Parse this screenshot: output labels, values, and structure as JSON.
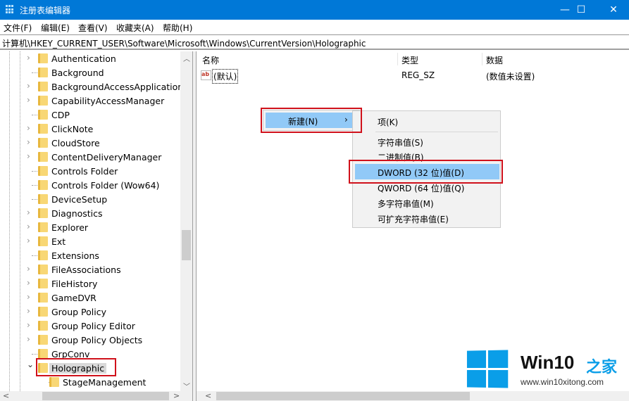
{
  "window": {
    "title": "注册表编辑器",
    "buttons": {
      "minimize": "—",
      "maximize": "☐",
      "close": "✕"
    }
  },
  "menu": [
    "文件(F)",
    "编辑(E)",
    "查看(V)",
    "收藏夹(A)",
    "帮助(H)"
  ],
  "address": "计算机\\HKEY_CURRENT_USER\\Software\\Microsoft\\Windows\\CurrentVersion\\Holographic",
  "tree": {
    "items": [
      {
        "label": "Authentication",
        "expandable": true
      },
      {
        "label": "Background",
        "expandable": false
      },
      {
        "label": "BackgroundAccessApplications",
        "expandable": true
      },
      {
        "label": "CapabilityAccessManager",
        "expandable": true
      },
      {
        "label": "CDP",
        "expandable": false
      },
      {
        "label": "ClickNote",
        "expandable": true
      },
      {
        "label": "CloudStore",
        "expandable": true
      },
      {
        "label": "ContentDeliveryManager",
        "expandable": true
      },
      {
        "label": "Controls Folder",
        "expandable": false
      },
      {
        "label": "Controls Folder (Wow64)",
        "expandable": false
      },
      {
        "label": "DeviceSetup",
        "expandable": false
      },
      {
        "label": "Diagnostics",
        "expandable": true
      },
      {
        "label": "Explorer",
        "expandable": true
      },
      {
        "label": "Ext",
        "expandable": true
      },
      {
        "label": "Extensions",
        "expandable": false
      },
      {
        "label": "FileAssociations",
        "expandable": true
      },
      {
        "label": "FileHistory",
        "expandable": true
      },
      {
        "label": "GameDVR",
        "expandable": true
      },
      {
        "label": "Group Policy",
        "expandable": true
      },
      {
        "label": "Group Policy Editor",
        "expandable": true
      },
      {
        "label": "Group Policy Objects",
        "expandable": true
      },
      {
        "label": "GrpConv",
        "expandable": false
      },
      {
        "label": "Holographic",
        "expandable": true,
        "expanded": true,
        "selected": true
      },
      {
        "label": "StageManagement",
        "expandable": false,
        "child": true
      }
    ]
  },
  "list": {
    "columns": [
      "名称",
      "类型",
      "数据"
    ],
    "rows": [
      {
        "name": "(默认)",
        "type": "REG_SZ",
        "data": "(数值未设置)",
        "icon": "string-value-icon"
      }
    ]
  },
  "context_menu": {
    "new_label": "新建(N)",
    "submenu": [
      "项(K)",
      "字符串值(S)",
      "二进制值(B)",
      "DWORD (32 位)值(D)",
      "QWORD (64 位)值(Q)",
      "多字符串值(M)",
      "可扩充字符串值(E)"
    ],
    "highlighted": "DWORD (32 位)值(D)"
  },
  "watermark": {
    "brand": "Win10",
    "brand_cn": "之家",
    "url": "www.win10xitong.com"
  },
  "colors": {
    "titlebar": "#0078d7",
    "highlight": "#91c9f7",
    "annotation": "#d0111b"
  }
}
